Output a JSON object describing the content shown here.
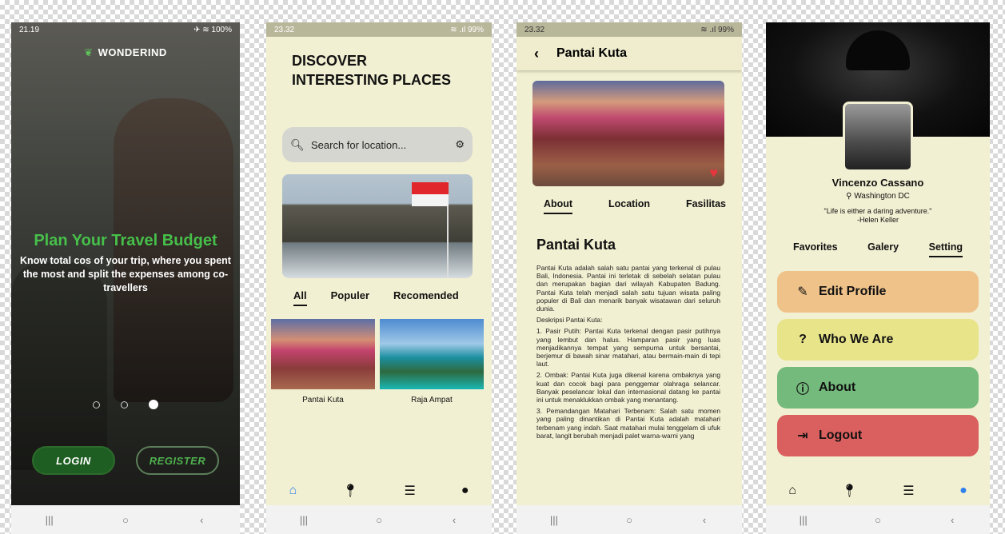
{
  "screen1": {
    "status_time": "21.19",
    "status_icons": "✈ ≋ 100%",
    "brand": "WONDERIND",
    "headline": "Plan Your Travel Budget",
    "subtitle": "Know total cos of your trip, where you spent the most and split the expenses among co-travellers",
    "login_label": "LOGIN",
    "register_label": "REGISTER"
  },
  "screen2": {
    "status_time": "23.32",
    "status_icons": "≋ .ıl 99%",
    "title_line1": "DISCOVER",
    "title_line2": "INTERESTING PLACES",
    "search_placeholder": "Search for location...",
    "tabs": [
      "All",
      "Populer",
      "Recomended"
    ],
    "cards": [
      {
        "caption": "Pantai Kuta"
      },
      {
        "caption": "Raja Ampat"
      }
    ]
  },
  "screen3": {
    "status_time": "23.32",
    "status_icons": "≋ .ıl 99%",
    "title": "Pantai Kuta",
    "tabs": [
      "About",
      "Location",
      "Fasilitas"
    ],
    "heading": "Pantai Kuta",
    "paragraphs": [
      "Pantai Kuta adalah salah satu pantai yang terkenal di pulau Bali, Indonesia. Pantai ini terletak di sebelah selatan pulau dan merupakan bagian dari wilayah Kabupaten Badung. Pantai Kuta telah menjadi salah satu tujuan wisata paling populer di Bali dan menarik banyak wisatawan dari seluruh dunia.",
      "Deskripsi Pantai Kuta:",
      "1. Pasir Putih: Pantai Kuta terkenal dengan pasir putihnya yang lembut dan halus. Hamparan pasir yang luas menjadikannya tempat yang sempurna untuk bersantai, berjemur di bawah sinar matahari, atau bermain-main di tepi laut.",
      "2. Ombak: Pantai Kuta juga dikenal karena ombaknya yang kuat dan cocok bagi para penggemar olahraga selancar. Banyak peselancar lokal dan internasional datang ke pantai ini untuk menaklukkan ombak yang menantang.",
      "3. Pemandangan Matahari Terbenam: Salah satu momen yang paling dinantikan di Pantai Kuta adalah matahari terbenam yang indah. Saat matahari mulai tenggelam di ufuk barat, langit berubah menjadi palet warna-warni yang"
    ]
  },
  "screen4": {
    "name": "Vincenzo Cassano",
    "location": "Washington DC",
    "quote_line1": "\"Life is either a daring adventure.\"",
    "quote_line2": "-Helen Keller",
    "tabs": [
      "Favorites",
      "Galery",
      "Setting"
    ],
    "menu": [
      "Edit Profile",
      "Who We Are",
      "About",
      "Logout"
    ]
  },
  "icons": {
    "home": "⌂",
    "pin": "⬤",
    "list": "☰",
    "user": "👤"
  }
}
